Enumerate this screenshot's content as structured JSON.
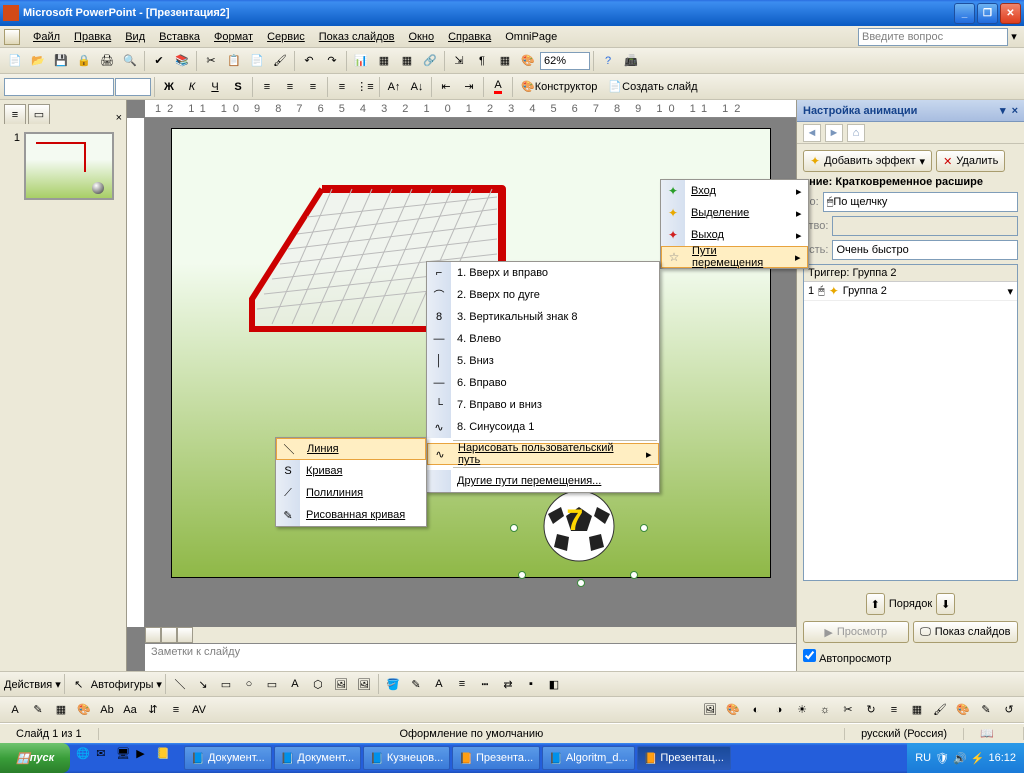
{
  "titlebar": {
    "title": "Microsoft PowerPoint - [Презентация2]"
  },
  "menu": {
    "file": "Файл",
    "edit": "Правка",
    "view": "Вид",
    "insert": "Вставка",
    "format": "Формат",
    "tools": "Сервис",
    "slideshow": "Показ слайдов",
    "window": "Окно",
    "help": "Справка",
    "omni": "OmniPage",
    "ask": "Введите вопрос"
  },
  "toolbar": {
    "zoom": "62%",
    "designer": "Конструктор",
    "newslide": "Создать слайд"
  },
  "ruler": "12 11 10 9 8 7 6 5 4 3 2 1 0 1 2 3 4 5 6 7 8 9 10 11 12",
  "thumb": {
    "num": "1"
  },
  "ball_number": "7",
  "notes": "Заметки к слайду",
  "task": {
    "title": "Настройка анимации",
    "add": "Добавить эффект",
    "remove": "Удалить",
    "change_label": "ение: Кратковременное расшире",
    "start_label": "ло:",
    "start_val": "По щелчку",
    "prop_label": "ство:",
    "speed_label": "ость:",
    "speed_val": "Очень быстро",
    "trigger": "Триггер: Группа 2",
    "item_num": "1",
    "item_name": "Группа 2",
    "order": "Порядок",
    "preview": "Просмотр",
    "play": "Показ слайдов",
    "auto": "Автопросмотр"
  },
  "menu_effects": {
    "entrance": "Вход",
    "emphasis": "Выделение",
    "exit": "Выход",
    "paths": "Пути перемещения"
  },
  "menu_paths": {
    "i1": "1. Вверх и вправо",
    "i2": "2. Вверх по дуге",
    "i3": "3. Вертикальный знак 8",
    "i4": "4. Влево",
    "i5": "5. Вниз",
    "i6": "6. Вправо",
    "i7": "7. Вправо и вниз",
    "i8": "8. Синусоида 1",
    "custom": "Нарисовать пользовательский путь",
    "more": "Другие пути перемещения..."
  },
  "menu_custom": {
    "line": "Линия",
    "curve": "Кривая",
    "poly": "Полилиния",
    "scribble": "Рисованная кривая"
  },
  "drawbar": {
    "actions": "Действия",
    "autoshapes": "Автофигуры"
  },
  "status": {
    "slide": "Слайд 1 из 1",
    "design": "Оформление по умолчанию",
    "lang": "русский (Россия)"
  },
  "taskbar": {
    "start": "пуск",
    "t1": "Документ...",
    "t2": "Документ...",
    "t3": "Кузнецов...",
    "t4": "Презента...",
    "t5": "Algoritm_d...",
    "t6": "Презентац...",
    "lang": "RU",
    "time": "16:12"
  }
}
